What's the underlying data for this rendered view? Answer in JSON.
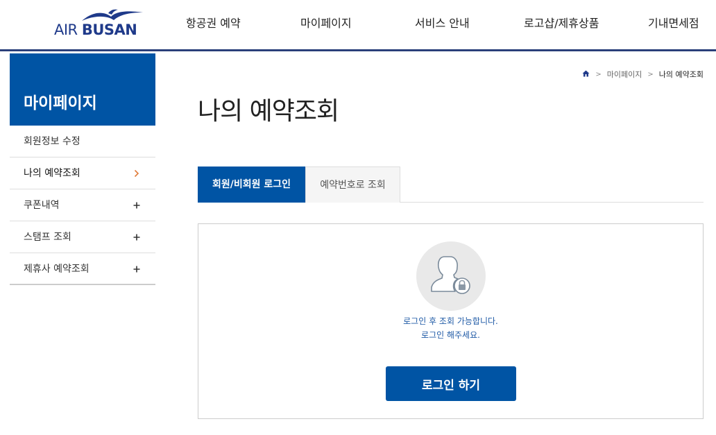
{
  "header": {
    "logo": {
      "air": "AIR",
      "busan": "BUSAN"
    },
    "nav": [
      "항공권 예약",
      "마이페이지",
      "서비스 안내",
      "로고샵/제휴상품",
      "기내면세점"
    ]
  },
  "sidebar": {
    "title": "마이페이지",
    "items": [
      {
        "label": "회원정보 수정",
        "mark": ""
      },
      {
        "label": "나의 예약조회",
        "mark": "chevron-right-icon"
      },
      {
        "label": "쿠폰내역",
        "mark": "plus-icon"
      },
      {
        "label": "스탬프 조회",
        "mark": "plus-icon"
      },
      {
        "label": "제휴사 예약조회",
        "mark": "plus-icon"
      }
    ]
  },
  "breadcrumb": {
    "home_icon": "home-icon",
    "level1": "마이페이지",
    "current": "나의 예약조회"
  },
  "main": {
    "title": "나의 예약조회",
    "tabs": [
      {
        "label": "회원/비회원 로그인",
        "active": true
      },
      {
        "label": "예약번호로 조회",
        "active": false
      }
    ],
    "login_box": {
      "icon": "locked-user-icon",
      "message_line1": "로그인 후 조회 가능합니다.",
      "message_line2": "로그인 해주세요.",
      "button_label": "로그인 하기"
    }
  },
  "colors": {
    "brand_blue": "#0054a4",
    "header_border": "#2a3f7a",
    "accent_orange": "#e07b39",
    "message_blue": "#1f5aa6"
  }
}
